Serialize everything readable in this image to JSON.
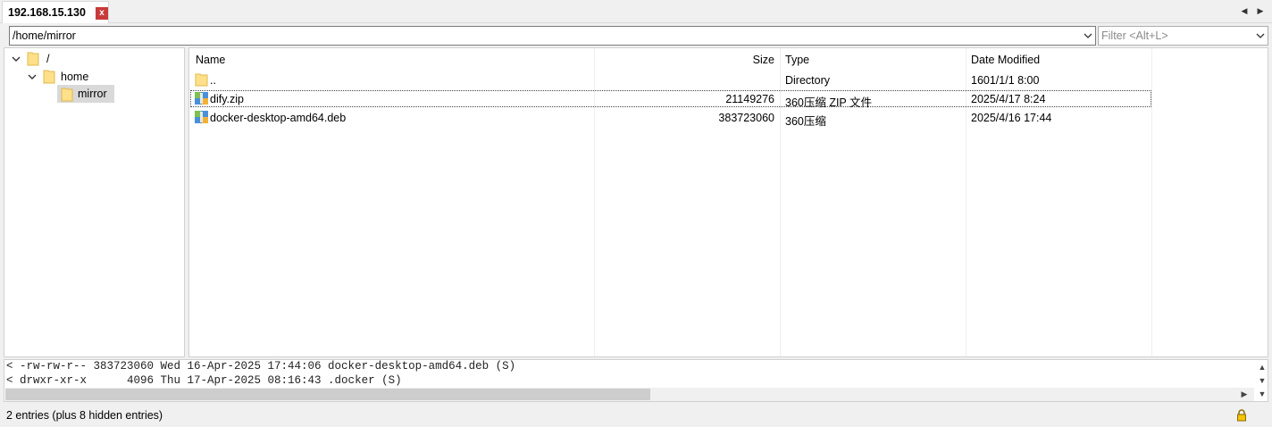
{
  "tab": {
    "title": "192.168.15.130",
    "close_glyph": "x",
    "close_color": "#c83a3a"
  },
  "nav": {
    "prev": "◀",
    "next": "▶"
  },
  "path": {
    "value": "/home/mirror"
  },
  "filter": {
    "placeholder": "Filter <Alt+L>"
  },
  "tree": {
    "nodes": [
      {
        "label": "/",
        "toggle": "chevron-down",
        "depth": 0
      },
      {
        "label": "home",
        "toggle": "chevron-down",
        "depth": 1
      },
      {
        "label": "mirror",
        "toggle": "none",
        "depth": 2,
        "selected": true
      }
    ]
  },
  "list": {
    "columns": [
      "Name",
      "Size",
      "Type",
      "Date Modified"
    ],
    "rows": [
      {
        "name": "..",
        "size": "",
        "type": "Directory",
        "date": "1601/1/1 8:00",
        "icon": "folder-icon"
      },
      {
        "name": "dify.zip",
        "size": "21149276",
        "type": "360压缩 ZIP 文件",
        "date": "2025/4/17 8:24",
        "icon": "archive-icon",
        "focused": true
      },
      {
        "name": "docker-desktop-amd64.deb",
        "size": "383723060",
        "type": "360压缩",
        "date": "2025/4/16 17:44",
        "icon": "archive-icon"
      }
    ]
  },
  "log": {
    "lines": [
      "< -rw-rw-r-- 383723060 Wed 16-Apr-2025 17:44:06 docker-desktop-amd64.deb (S)",
      "< drwxr-xr-x      4096 Thu 17-Apr-2025 08:16:43 .docker (S)"
    ]
  },
  "status": {
    "text": "2 entries (plus 8 hidden entries)"
  },
  "colors": {
    "folder": "#ffe08a",
    "folder_stroke": "#e0b84a",
    "selection": "#d9d9d9"
  }
}
